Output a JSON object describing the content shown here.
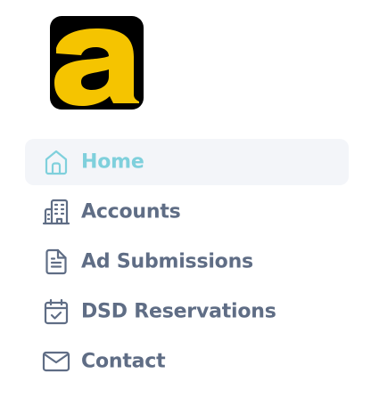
{
  "brand": {
    "logo_letter": "a",
    "logo_icon": "brand-a-logo",
    "colors": {
      "background": "#000000",
      "letter": "#f5c400"
    }
  },
  "colors": {
    "active_text": "#7fd0dc",
    "inactive_text": "#5f6d85",
    "active_background": "#f3f5f9"
  },
  "nav": {
    "items": [
      {
        "label": "Home",
        "icon": "home-icon",
        "active": true
      },
      {
        "label": "Accounts",
        "icon": "building-icon",
        "active": false
      },
      {
        "label": "Ad Submissions",
        "icon": "document-icon",
        "active": false
      },
      {
        "label": "DSD Reservations",
        "icon": "calendar-check-icon",
        "active": false
      },
      {
        "label": "Contact",
        "icon": "mail-icon",
        "active": false
      }
    ]
  }
}
